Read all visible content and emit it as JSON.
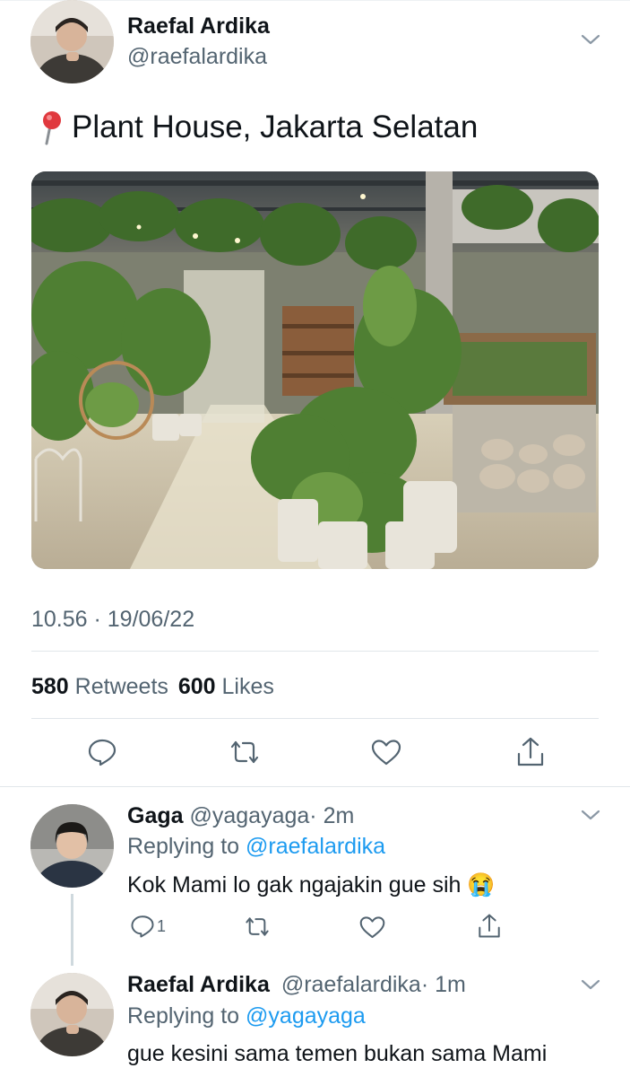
{
  "main_tweet": {
    "author_name": "Raefal Ardika",
    "author_handle": "@raefalardika",
    "pin_emoji": "📍",
    "text": "Plant House, Jakarta Selatan",
    "timestamp": "10.56 · 19/06/22",
    "retweets_count": "580",
    "retweets_label": "Retweets",
    "likes_count": "600",
    "likes_label": "Likes"
  },
  "replies": [
    {
      "author_name": "Gaga",
      "author_handle": "@yagayaga",
      "time": "· 2m",
      "replying_prefix": "Replying to",
      "replying_to": "@raefalardika",
      "text": "Kok Mami lo gak ngajakin gue sih",
      "emoji": "😭",
      "reply_count": "1"
    },
    {
      "author_name": "Raefal Ardika",
      "author_handle": "@raefalardika",
      "time": "· 1m",
      "replying_prefix": "Replying to",
      "replying_to": "@yagayaga",
      "text": "gue kesini sama temen bukan sama Mami"
    }
  ],
  "colors": {
    "accent": "#1d9bf0",
    "muted": "#536471",
    "divider": "#e1e6ea"
  },
  "icons": [
    "chevron-down-icon",
    "pin-icon",
    "reply-icon",
    "retweet-icon",
    "like-icon",
    "share-icon"
  ]
}
